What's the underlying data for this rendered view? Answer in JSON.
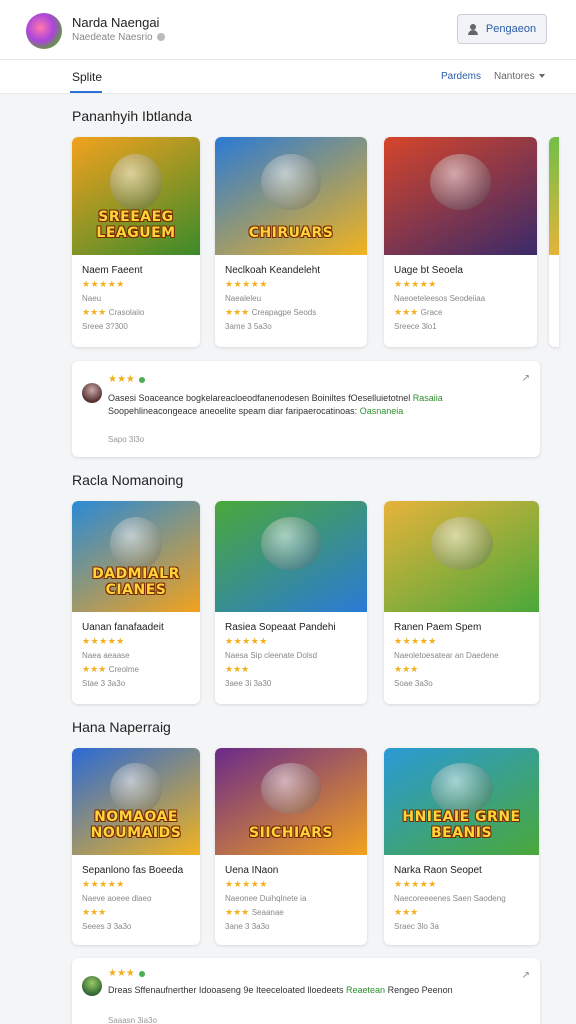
{
  "header": {
    "user_name": "Narda Naengai",
    "user_sub": "Naedeate Naesrio",
    "button_label": "Pengaeon"
  },
  "tabs": {
    "active": "Splite",
    "right1": "Pardems",
    "right2": "Nantores"
  },
  "sections": [
    {
      "title": "Pananhyih Ibtlanda",
      "cards": [
        {
          "title": "Naem Faeent",
          "line1": "Naeu",
          "line2": "Crasolaiio",
          "line3": "Sreee 3?300",
          "thumb_text": "SREEAEG LEAGUEM",
          "colors": [
            "#f2a21e",
            "#3b8a2a"
          ]
        },
        {
          "title": "Neclkoah Keandeleht",
          "line1": "Naealeleu",
          "line2": "Creapagpe Seods",
          "line3": "3ame 3 5a3o",
          "thumb_text": "CHIRUARS",
          "colors": [
            "#2a7ad6",
            "#f2b31e"
          ]
        },
        {
          "title": "Uage bt Seoela",
          "line1": "Naeoeteleesos Seodeiiaa",
          "line2": "Grace",
          "line3": "Sreece 3lo1",
          "thumb_text": "",
          "colors": [
            "#d6452a",
            "#3a2a6a"
          ]
        }
      ]
    },
    {
      "title": "Racla Nomanoing",
      "cards": [
        {
          "title": "Uanan fanafaadeit",
          "line1": "Naea aeaase",
          "line2": "Creolme",
          "line3": "Stae 3 3a3o",
          "thumb_text": "DADMIALR CIANES",
          "colors": [
            "#2a8ad6",
            "#f2a21e"
          ]
        },
        {
          "title": "Rasiea Sopeaat Pandehi",
          "line1": "Naesa Sip cleenate Dolsd",
          "line2": "",
          "line3": "3aee 3i 3a30",
          "thumb_text": "",
          "colors": [
            "#4aa83a",
            "#2a7ad6"
          ]
        },
        {
          "title": "Ranen Paem Spem",
          "line1": "Naeoletoesatear an Daedene",
          "line2": "",
          "line3": "Soae 3a3o",
          "thumb_text": "",
          "colors": [
            "#e6b33a",
            "#4aa83a"
          ]
        }
      ]
    },
    {
      "title": "Hana Naperraig",
      "cards": [
        {
          "title": "Sepanlono fas Boeeda",
          "line1": "Naeve aoeee dlaeo",
          "line2": "",
          "line3": "Seees 3 3a3o",
          "thumb_text": "NOMAOAE NOUMAIDS",
          "colors": [
            "#2a6ad6",
            "#f2b31e"
          ]
        },
        {
          "title": "Uena INaon",
          "line1": "Naeonee Duihqlnete ia",
          "line2": "Seaanae",
          "line3": "3ane 3 3a3o",
          "thumb_text": "SIICHIARS",
          "colors": [
            "#6a2a8a",
            "#f2a21e"
          ]
        },
        {
          "title": "Narka Raon Seopet",
          "line1": "Naecoreeeenes Saen Saodeng",
          "line2": "",
          "line3": "Sraec 3lo 3a",
          "thumb_text": "HNIEAIE GRNE BEANIS",
          "colors": [
            "#2a9ad6",
            "#4aa83a"
          ]
        }
      ]
    }
  ],
  "reviews": [
    {
      "text": "Oasesi Soaceance bogkelareacloeodfanenodesen Boiniltes fOeselluietotnel",
      "text2": "Soopehlineacongeace aneoelite speam diar faripaerocatinoas:",
      "hl1": "Rasaiia",
      "hl2": "Oasnaneia",
      "date": "Sapo 3l3o"
    },
    {
      "text": "Dreas Sffenaufnerther Idooaseng 9e Iteeceloated lloedeets",
      "text2": "",
      "hl1": "Reaetean",
      "hl2": "Rengeo",
      "extra": "Peenon",
      "date": "Saaasn 3ia3o"
    }
  ]
}
